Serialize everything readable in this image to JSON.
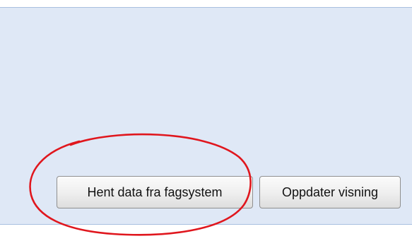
{
  "toolbar": {
    "fetch_button_label": "Hent data fra fagsystem",
    "refresh_button_label": "Oppdater visning"
  },
  "colors": {
    "panel_background": "#dfe8f6",
    "panel_border": "#a8c0e0",
    "annotation": "#e0161d"
  }
}
